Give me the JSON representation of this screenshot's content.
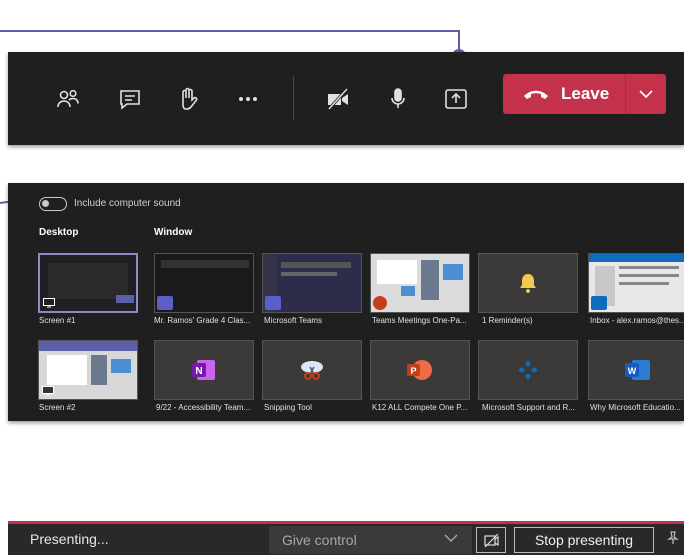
{
  "toolbar": {
    "icons": [
      "participants-icon",
      "chat-icon",
      "raise-hand-icon",
      "more-icon",
      "camera-off-icon",
      "microphone-icon",
      "share-icon"
    ],
    "leave_label": "Leave"
  },
  "share_panel": {
    "include_sound_label": "Include computer sound",
    "desktop_heading": "Desktop",
    "window_heading": "Window",
    "row1": [
      {
        "label": "Screen #1",
        "kind": "screen"
      },
      {
        "label": "Mr. Ramos' Grade 4 Clas...",
        "kind": "window"
      },
      {
        "label": "Microsoft Teams",
        "kind": "window"
      },
      {
        "label": "Teams Meetings One-Pa...",
        "kind": "window"
      },
      {
        "label": "1 Reminder(s)",
        "kind": "window"
      },
      {
        "label": "Inbox - alex.ramos@thes...",
        "kind": "window"
      }
    ],
    "row2": [
      {
        "label": "Screen #2",
        "kind": "screen"
      },
      {
        "label": "9/22 - Accessibility Team...",
        "kind": "window"
      },
      {
        "label": "Snipping Tool",
        "kind": "window"
      },
      {
        "label": "K12 ALL Compete One P...",
        "kind": "window"
      },
      {
        "label": "Microsoft Support and R...",
        "kind": "window"
      },
      {
        "label": "Why Microsoft Educatio...",
        "kind": "window"
      }
    ]
  },
  "presenting_bar": {
    "status_label": "Presenting...",
    "give_control_label": "Give control",
    "stop_label": "Stop presenting"
  },
  "colors": {
    "accent": "#5b5fa8",
    "leave_red": "#c4314b",
    "dark_bg": "#1f1f1f"
  }
}
